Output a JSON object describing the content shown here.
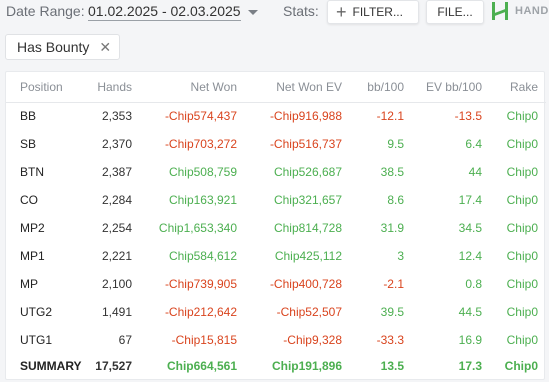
{
  "toolbar": {
    "date_label": "Date Range:",
    "date_value": "01.02.2025 - 02.03.2025",
    "stats_label": "Stats:",
    "filter_label": "FILTER...",
    "file_label": "FILE...",
    "logo_text": "HAND"
  },
  "filter_chip": {
    "label": "Has Bounty"
  },
  "colors": {
    "positive": "#4caf50",
    "negative": "#d9441e",
    "muted": "#8a8f96"
  },
  "table": {
    "headers": [
      "Position",
      "Hands",
      "Net Won",
      "Net Won EV",
      "bb/100",
      "EV bb/100",
      "Rake"
    ],
    "rows": [
      {
        "position": "BB",
        "hands": "2,353",
        "net_won": "-Chip574,437",
        "net_won_ev": "-Chip916,988",
        "bb100": "-12.1",
        "ev_bb100": "-13.5",
        "rake": "Chip0"
      },
      {
        "position": "SB",
        "hands": "2,370",
        "net_won": "-Chip703,272",
        "net_won_ev": "-Chip516,737",
        "bb100": "9.5",
        "ev_bb100": "6.4",
        "rake": "Chip0"
      },
      {
        "position": "BTN",
        "hands": "2,387",
        "net_won": "Chip508,759",
        "net_won_ev": "Chip526,687",
        "bb100": "38.5",
        "ev_bb100": "44",
        "rake": "Chip0"
      },
      {
        "position": "CO",
        "hands": "2,284",
        "net_won": "Chip163,921",
        "net_won_ev": "Chip321,657",
        "bb100": "8.6",
        "ev_bb100": "17.4",
        "rake": "Chip0"
      },
      {
        "position": "MP2",
        "hands": "2,254",
        "net_won": "Chip1,653,340",
        "net_won_ev": "Chip814,728",
        "bb100": "31.9",
        "ev_bb100": "34.5",
        "rake": "Chip0"
      },
      {
        "position": "MP1",
        "hands": "2,221",
        "net_won": "Chip584,612",
        "net_won_ev": "Chip425,112",
        "bb100": "3",
        "ev_bb100": "12.4",
        "rake": "Chip0"
      },
      {
        "position": "MP",
        "hands": "2,100",
        "net_won": "-Chip739,905",
        "net_won_ev": "-Chip400,728",
        "bb100": "-2.1",
        "ev_bb100": "0.8",
        "rake": "Chip0"
      },
      {
        "position": "UTG2",
        "hands": "1,491",
        "net_won": "-Chip212,642",
        "net_won_ev": "-Chip52,507",
        "bb100": "39.5",
        "ev_bb100": "44.5",
        "rake": "Chip0"
      },
      {
        "position": "UTG1",
        "hands": "67",
        "net_won": "-Chip15,815",
        "net_won_ev": "-Chip9,328",
        "bb100": "-33.3",
        "ev_bb100": "16.9",
        "rake": "Chip0"
      }
    ],
    "summary": {
      "position": "SUMMARY",
      "hands": "17,527",
      "net_won": "Chip664,561",
      "net_won_ev": "Chip191,896",
      "bb100": "13.5",
      "ev_bb100": "17.3",
      "rake": "Chip0"
    }
  }
}
